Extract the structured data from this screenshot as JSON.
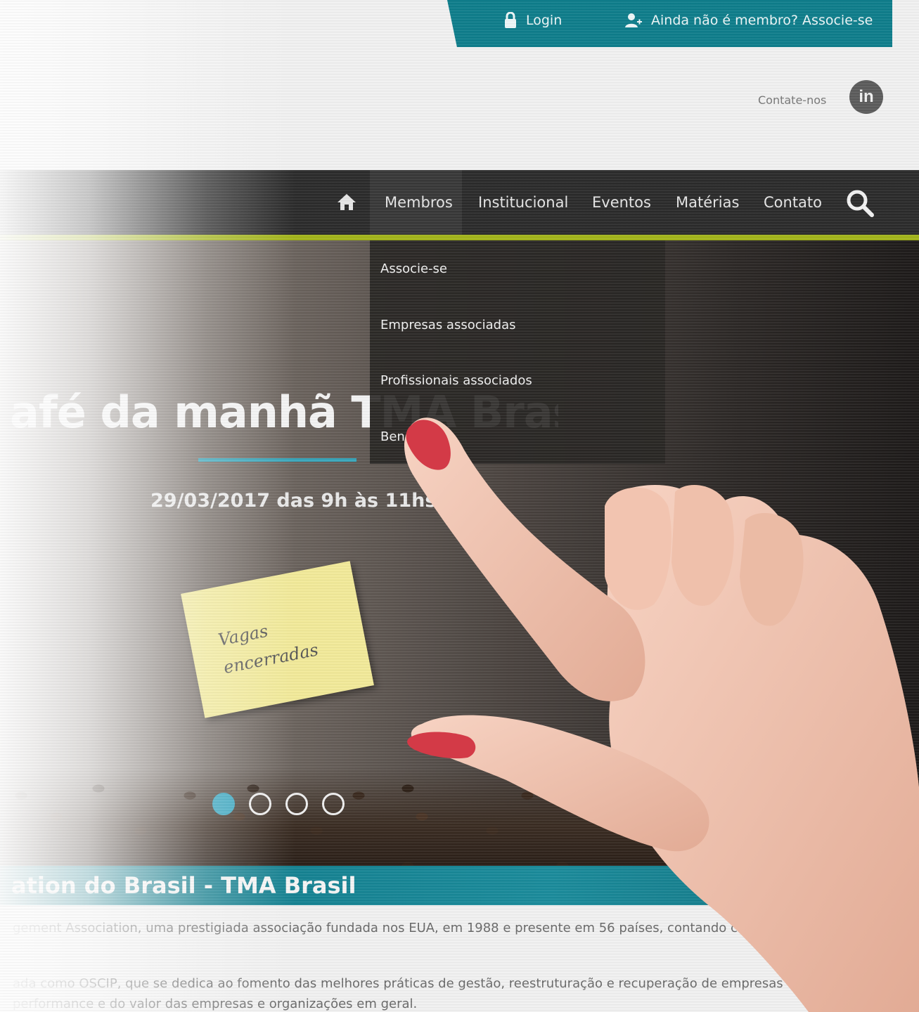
{
  "topbar": {
    "login_label": "Login",
    "join_label": "Ainda não é membro? Associe-se"
  },
  "header": {
    "contact_label": "Contate-nos",
    "linkedin_label": "in"
  },
  "nav": {
    "items": [
      "Membros",
      "Institucional",
      "Eventos",
      "Matérias",
      "Contato"
    ],
    "active": "Membros"
  },
  "dropdown": {
    "items": [
      "Associe-se",
      "Empresas associadas",
      "Profissionais associados",
      "Ben"
    ]
  },
  "hero": {
    "title": "afé da manhã TMA Brasil",
    "date": "29/03/2017 das 9h às 11hs",
    "note_line1": "Vagas",
    "note_line2": "encerradas",
    "slides_total": 4,
    "slide_active": 1
  },
  "section": {
    "band_title": "ation do Brasil - TMA Brasil",
    "paragraph1": "gement Association, uma prestigiada associação fundada nos EUA, em 1988 e presente em 56 países, contando com",
    "paragraph2_line1": "ada como OSCIP, que se dedica ao fomento das melhores práticas de gestão, reestruturação e recuperação de empresas em s",
    "paragraph2_line2": "performance e do valor das empresas e organizações em geral."
  },
  "colors": {
    "teal": "#0e7e8c",
    "nav_dark": "#2b2b2b",
    "accent_green": "#a3b51a",
    "slider_blue": "#37a6bb"
  }
}
